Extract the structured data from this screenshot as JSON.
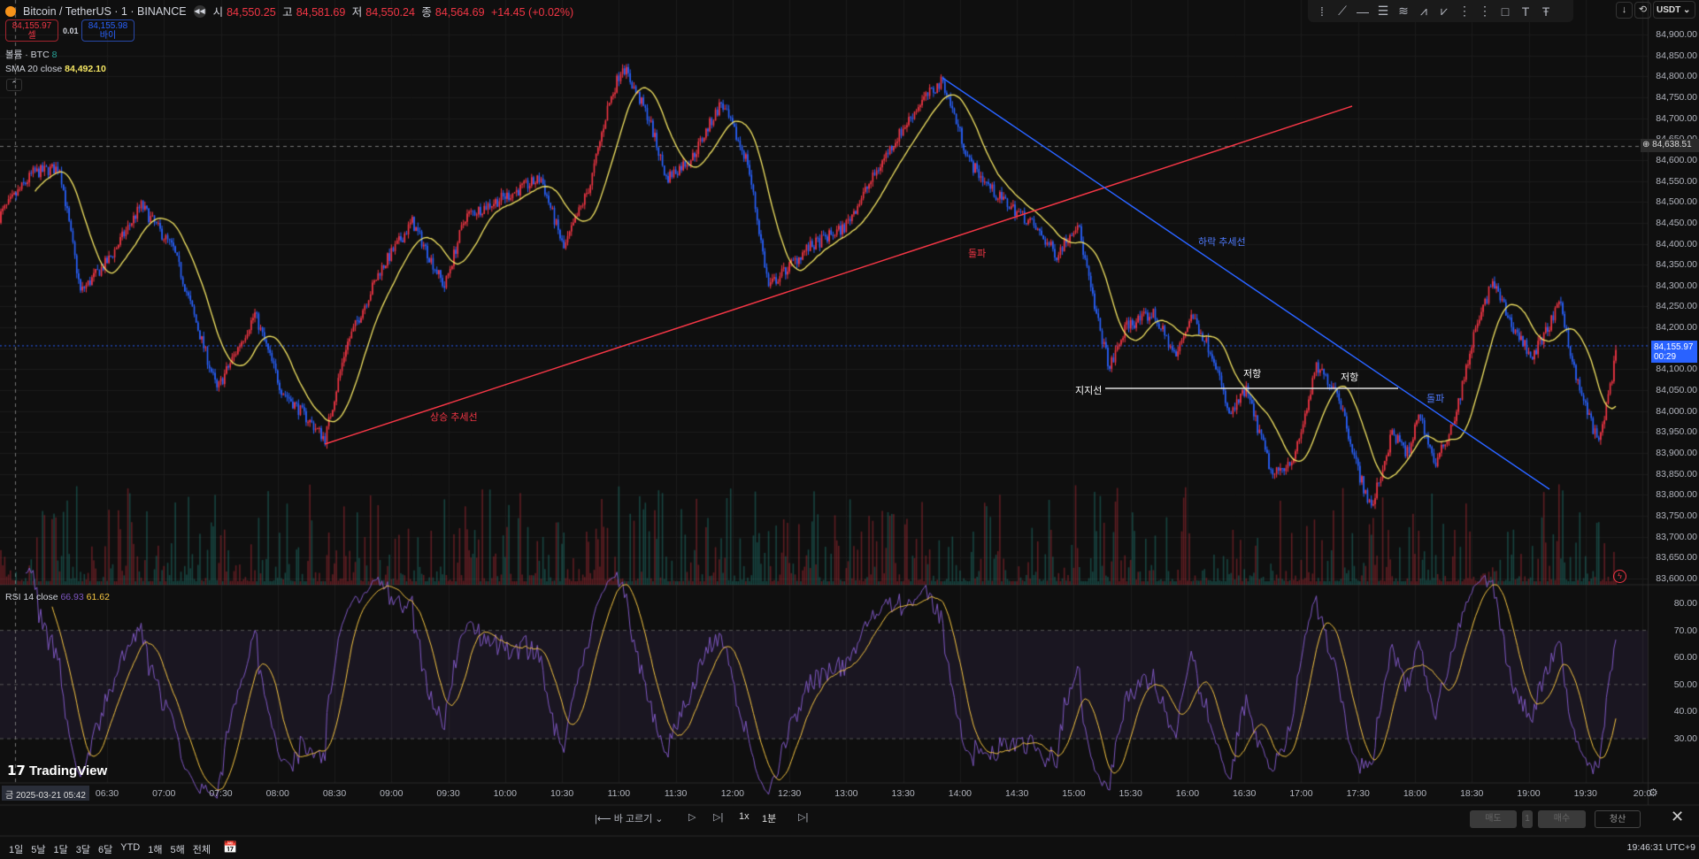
{
  "header": {
    "symbol": "Bitcoin / TetherUS · 1 · BINANCE",
    "open_label": "시",
    "open": "84,550.25",
    "high_label": "고",
    "high": "84,581.69",
    "low_label": "저",
    "low": "84,550.24",
    "close_label": "종",
    "close": "84,564.69",
    "change": "+14.45 (+0.02%)"
  },
  "trade": {
    "sell_price": "84,155.97",
    "sell_label": "셀",
    "spread": "0.01",
    "buy_price": "84,155.98",
    "buy_label": "바이"
  },
  "indicators": {
    "volume_label": "볼륨 · BTC",
    "volume_value": "8",
    "sma_label": "SMA 20 close",
    "sma_value": "84,492.10",
    "rsi_label": "RSI 14 close",
    "rsi_value": "66.93",
    "rsi_ma_value": "61.62"
  },
  "toolbar": {
    "currency": "USDT",
    "icons": [
      "drag-handle-icon",
      "trend-line-icon",
      "horizontal-ray-icon",
      "parallel-channel-icon",
      "fib-retracement-icon",
      "elliott-wave-icon",
      "abcd-pattern-icon",
      "long-position-icon",
      "short-position-icon",
      "rectangle-icon",
      "text-icon",
      "anchored-text-icon"
    ]
  },
  "price_axis": {
    "labels": [
      "84,900.00",
      "84,850.00",
      "84,800.00",
      "84,750.00",
      "84,700.00",
      "84,650.00",
      "84,600.00",
      "84,550.00",
      "84,500.00",
      "84,450.00",
      "84,400.00",
      "84,350.00",
      "84,300.00",
      "84,250.00",
      "84,200.00",
      "84,150.00",
      "84,100.00",
      "84,050.00",
      "84,000.00",
      "83,950.00",
      "83,900.00",
      "83,850.00",
      "83,800.00",
      "83,750.00",
      "83,700.00",
      "83,650.00",
      "83,600.00"
    ],
    "crosshair_price": "84,638.51",
    "last_price": "84,155.97",
    "countdown": "00:29"
  },
  "rsi_axis": {
    "labels": [
      "80.00",
      "70.00",
      "60.00",
      "50.00",
      "40.00",
      "30.00"
    ]
  },
  "time_axis": {
    "crosshair_date": "금 2025-03-21  05:42",
    "labels": [
      "06:30",
      "07:00",
      "07:30",
      "08:00",
      "08:30",
      "09:00",
      "09:30",
      "10:00",
      "10:30",
      "11:00",
      "11:30",
      "12:00",
      "12:30",
      "13:00",
      "13:30",
      "14:00",
      "14:30",
      "15:00",
      "15:30",
      "16:00",
      "16:30",
      "17:00",
      "17:30",
      "18:00",
      "18:30",
      "19:00",
      "19:30",
      "20:0"
    ]
  },
  "drawings": {
    "uptrend": "상승 추세선",
    "breakout1": "돌파",
    "downtrend": "하락 추세선",
    "support": "지지선",
    "resist1": "저항",
    "resist2": "저항",
    "breakout2": "돌파"
  },
  "replay": {
    "select_bar": "바 고르기",
    "speed": "1x",
    "interval": "1분",
    "sell": "매도",
    "qty": "1",
    "buy": "매수",
    "close_position": "청산"
  },
  "bottom": {
    "ranges": [
      "1일",
      "5날",
      "1달",
      "3달",
      "6달",
      "YTD",
      "1해",
      "5해",
      "전체"
    ],
    "clock": "19:46:31 UTC+9"
  },
  "brand": {
    "logo": "TradingView"
  },
  "colors": {
    "up": "#f23645",
    "down": "#2962ff",
    "sma": "#f5e663",
    "rsi": "#7e57c2",
    "rsi_ma": "#f5c542"
  },
  "chart_data": {
    "type": "candlestick",
    "interval": "1m",
    "x_unit": "minute of day",
    "ylim": [
      83600,
      84900
    ],
    "price_path": [
      [
        333,
        84465
      ],
      [
        351,
        84569
      ],
      [
        365,
        84582
      ],
      [
        376,
        84284
      ],
      [
        391,
        84362
      ],
      [
        408,
        84491
      ],
      [
        425,
        84387
      ],
      [
        448,
        84051
      ],
      [
        468,
        84232
      ],
      [
        482,
        84051
      ],
      [
        505,
        83934
      ],
      [
        516,
        84154
      ],
      [
        534,
        84336
      ],
      [
        551,
        84452
      ],
      [
        568,
        84297
      ],
      [
        579,
        84465
      ],
      [
        602,
        84517
      ],
      [
        619,
        84556
      ],
      [
        631,
        84387
      ],
      [
        645,
        84543
      ],
      [
        654,
        84724
      ],
      [
        662,
        84828
      ],
      [
        676,
        84698
      ],
      [
        685,
        84556
      ],
      [
        699,
        84608
      ],
      [
        714,
        84737
      ],
      [
        728,
        84595
      ],
      [
        739,
        84297
      ],
      [
        759,
        84387
      ],
      [
        779,
        84439
      ],
      [
        802,
        84620
      ],
      [
        819,
        84737
      ],
      [
        831,
        84789
      ],
      [
        845,
        84595
      ],
      [
        859,
        84517
      ],
      [
        877,
        84452
      ],
      [
        891,
        84374
      ],
      [
        902,
        84452
      ],
      [
        911,
        84245
      ],
      [
        919,
        84103
      ],
      [
        928,
        84206
      ],
      [
        942,
        84232
      ],
      [
        954,
        84129
      ],
      [
        962,
        84232
      ],
      [
        974,
        84129
      ],
      [
        982,
        83986
      ],
      [
        991,
        84051
      ],
      [
        1005,
        83843
      ],
      [
        1017,
        83895
      ],
      [
        1028,
        84103
      ],
      [
        1039,
        84051
      ],
      [
        1051,
        83843
      ],
      [
        1057,
        83766
      ],
      [
        1068,
        83947
      ],
      [
        1077,
        83895
      ],
      [
        1082,
        83999
      ],
      [
        1091,
        83869
      ],
      [
        1102,
        83999
      ],
      [
        1111,
        84180
      ],
      [
        1121,
        84310
      ],
      [
        1131,
        84206
      ],
      [
        1142,
        84129
      ],
      [
        1157,
        84258
      ],
      [
        1165,
        84077
      ],
      [
        1177,
        83921
      ],
      [
        1187,
        84155
      ]
    ],
    "rsi_levels": [
      70,
      50,
      30
    ],
    "rsi_ylim": [
      20,
      85
    ]
  }
}
